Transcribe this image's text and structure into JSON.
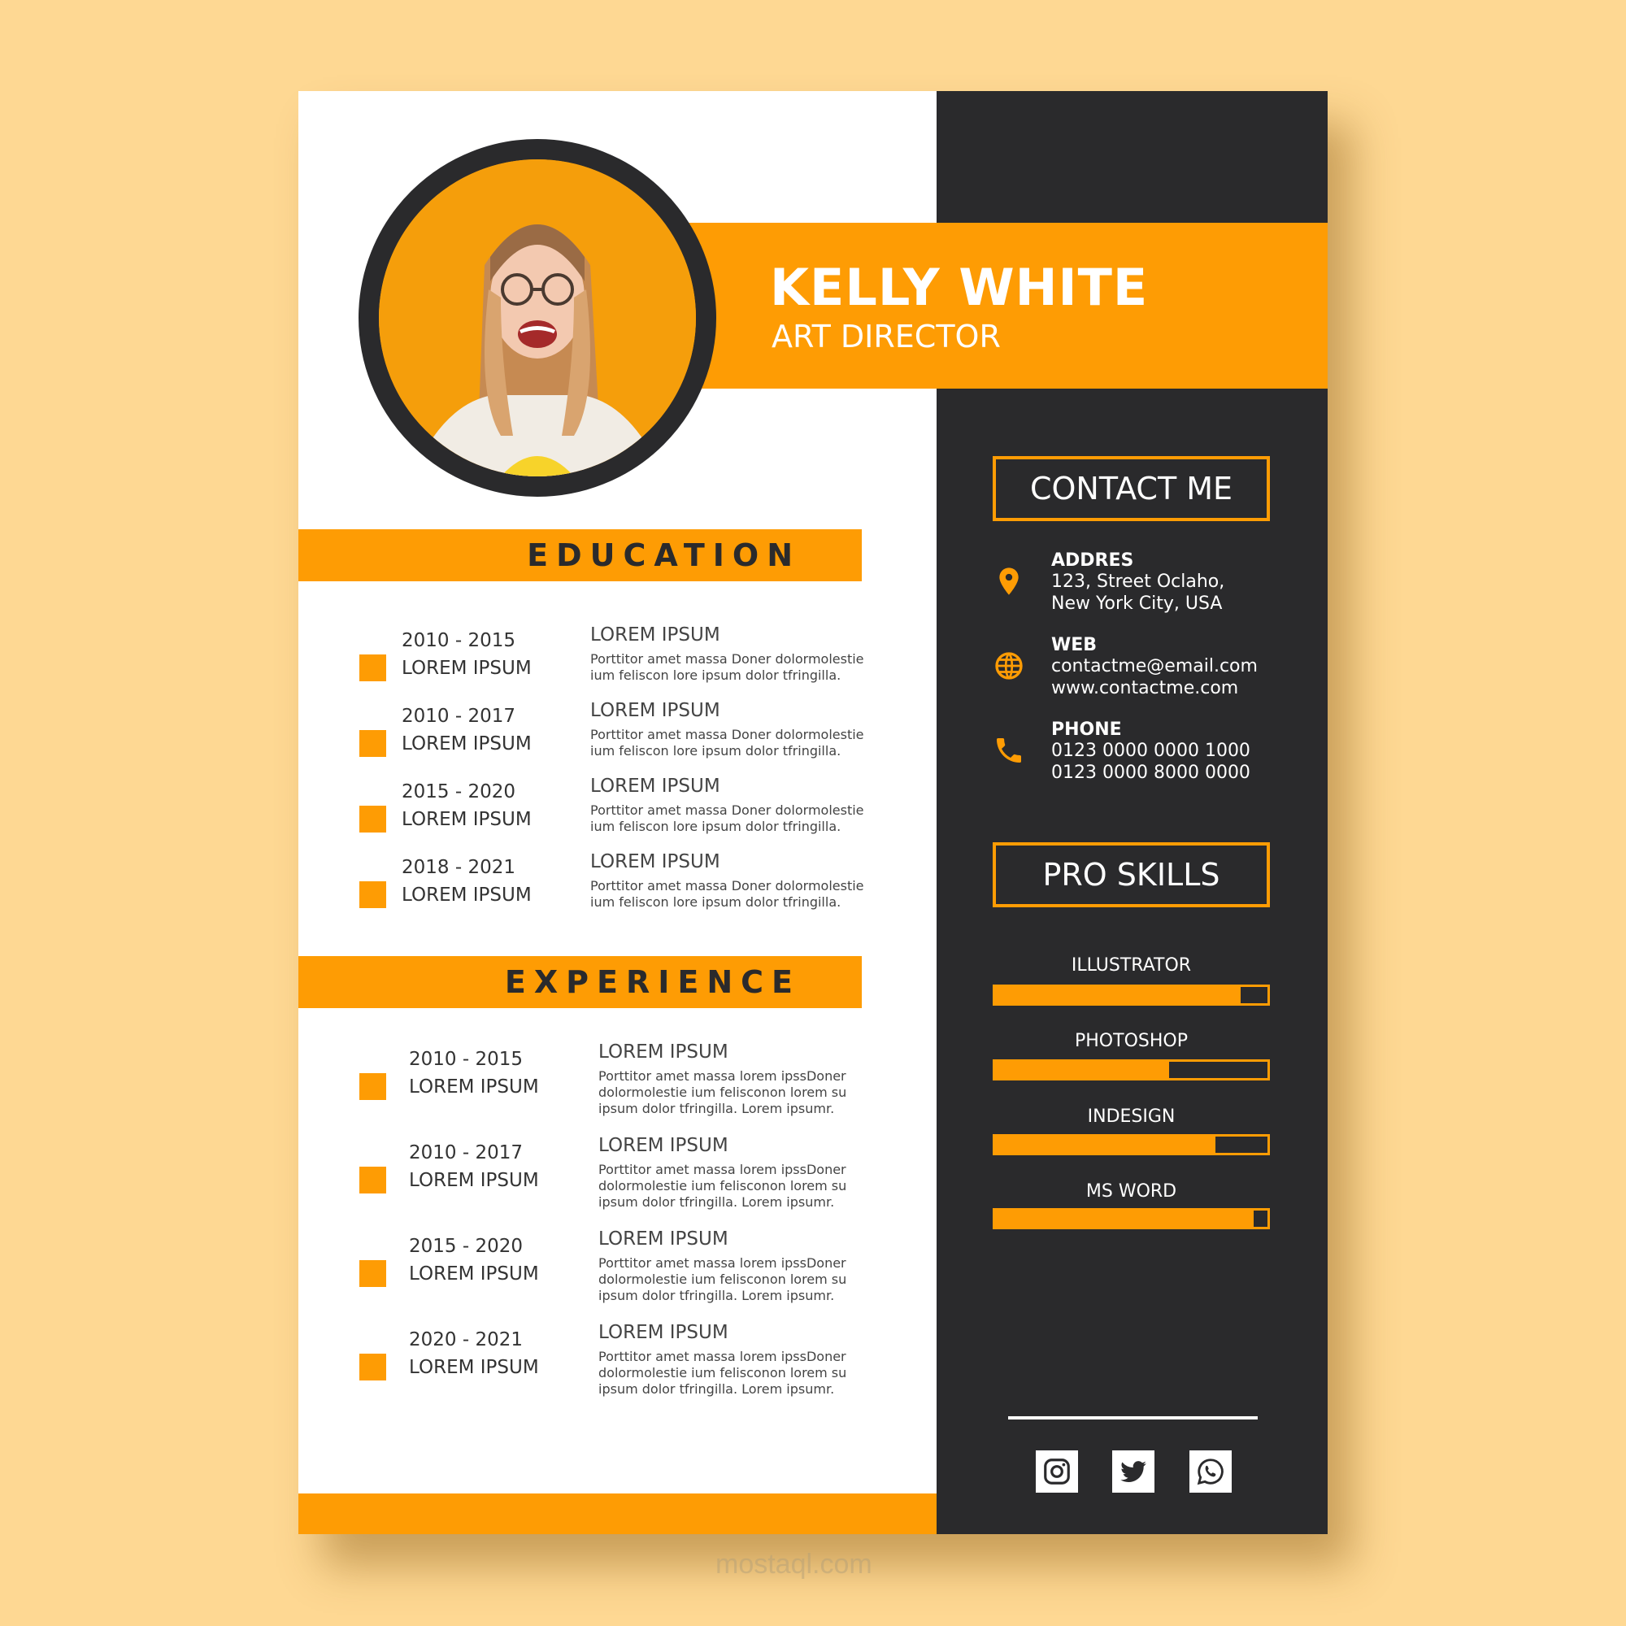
{
  "header": {
    "name": "KELLY WHITE",
    "role": "ART DIRECTOR"
  },
  "photo": {
    "alt": "profile-photo"
  },
  "education": {
    "title": "EDUCATION",
    "items": [
      {
        "date": "2010 - 2015",
        "label": "LOREM IPSUM",
        "title": "LOREM IPSUM",
        "desc": [
          "Porttitor amet massa Doner dolormolestie",
          "ium feliscon lore  ipsum dolor tfringilla."
        ]
      },
      {
        "date": "2010 - 2017",
        "label": "LOREM IPSUM",
        "title": "LOREM IPSUM",
        "desc": [
          "Porttitor amet massa Doner dolormolestie",
          "ium feliscon lore  ipsum dolor tfringilla."
        ]
      },
      {
        "date": "2015 - 2020",
        "label": "LOREM IPSUM",
        "title": "LOREM IPSUM",
        "desc": [
          "Porttitor amet massa Doner dolormolestie",
          "ium feliscon lore  ipsum dolor tfringilla."
        ]
      },
      {
        "date": "2018 - 2021",
        "label": "LOREM IPSUM",
        "title": "LOREM IPSUM",
        "desc": [
          "Porttitor amet massa Doner dolormolestie",
          "ium feliscon lore  ipsum dolor tfringilla."
        ]
      }
    ]
  },
  "experience": {
    "title": "EXPERIENCE",
    "items": [
      {
        "date": "2010 - 2015",
        "label": "LOREM IPSUM",
        "title": "LOREM IPSUM",
        "desc": [
          "Porttitor amet massa lorem ipssDoner",
          "dolormolestie ium felisconon lorem su",
          "ipsum dolor tfringilla. Lorem ipsumr."
        ]
      },
      {
        "date": "2010 - 2017",
        "label": "LOREM IPSUM",
        "title": "LOREM IPSUM",
        "desc": [
          "Porttitor amet massa lorem ipssDoner",
          "dolormolestie ium felisconon lorem su",
          "ipsum dolor tfringilla. Lorem ipsumr."
        ]
      },
      {
        "date": "2015 - 2020",
        "label": "LOREM IPSUM",
        "title": "LOREM IPSUM",
        "desc": [
          "Porttitor amet massa lorem ipssDoner",
          "dolormolestie ium felisconon lorem su",
          "ipsum dolor tfringilla. Lorem ipsumr."
        ]
      },
      {
        "date": "2020 - 2021",
        "label": "LOREM IPSUM",
        "title": "LOREM IPSUM",
        "desc": [
          "Porttitor amet massa lorem ipssDoner",
          "dolormolestie ium felisconon lorem su",
          "ipsum dolor tfringilla. Lorem ipsumr."
        ]
      }
    ]
  },
  "contact": {
    "title": "CONTACT ME",
    "items": [
      {
        "icon": "location-pin-icon",
        "heading": "ADDRES",
        "line1": "123, Street Oclaho,",
        "line2": "New York City, USA"
      },
      {
        "icon": "globe-icon",
        "heading": "WEB",
        "line1": "contactme@email.com",
        "line2": "www.contactme.com"
      },
      {
        "icon": "phone-icon",
        "heading": "PHONE",
        "line1": "0123 0000 0000 1000",
        "line2": "0123 0000 8000 0000"
      }
    ]
  },
  "skills": {
    "title": "PRO SKILLS",
    "items": [
      {
        "name": "ILLUSTRATOR",
        "level": 0.9
      },
      {
        "name": "PHOTOSHOP",
        "level": 0.64
      },
      {
        "name": "INDESIGN",
        "level": 0.81
      },
      {
        "name": "MS WORD",
        "level": 0.95
      }
    ]
  },
  "social": [
    {
      "icon": "instagram-icon"
    },
    {
      "icon": "twitter-icon"
    },
    {
      "icon": "whatsapp-icon"
    }
  ],
  "watermark": "mostaql.com",
  "colors": {
    "accent": "#fe9c04",
    "dark": "#2a2a2c",
    "background": "#fed893",
    "paper": "#ffffff"
  }
}
